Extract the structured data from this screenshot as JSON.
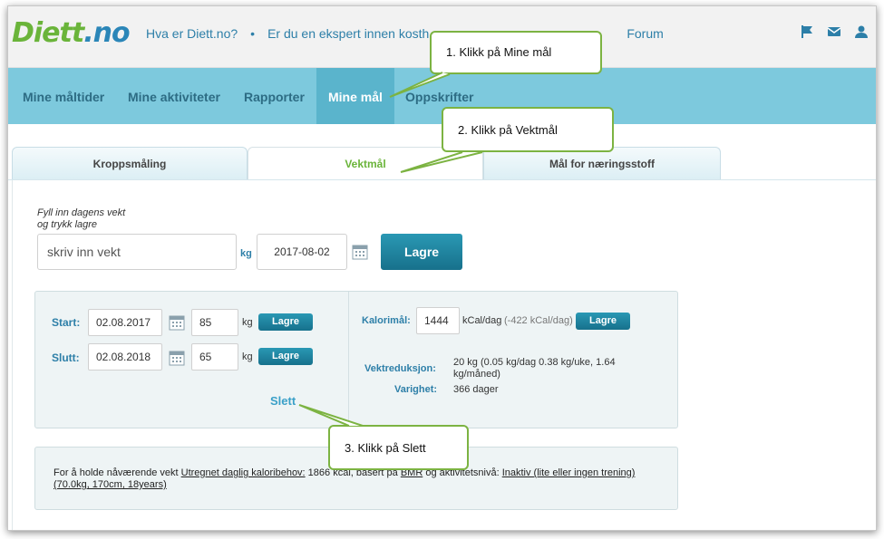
{
  "logo": {
    "part1": "Diett",
    "part2": ".no"
  },
  "topnav": {
    "link1": "Hva er Diett.no?",
    "link2": "Er du en ekspert innen kosth",
    "link3": "Forum"
  },
  "mainnav": {
    "items": [
      "Mine måltider",
      "Mine aktiviteter",
      "Rapporter",
      "Mine mål",
      "Oppskrifter"
    ]
  },
  "tabs": [
    "Kroppsmåling",
    "Vektmål",
    "Mål for næringsstoff"
  ],
  "weight_form": {
    "hint_line1": "Fyll inn dagens vekt",
    "hint_line2": "og trykk lagre",
    "weight_placeholder": "skriv inn vekt",
    "unit": "kg",
    "date_value": "2017-08-02",
    "save_label": "Lagre"
  },
  "goal_panel": {
    "start_label": "Start:",
    "start_date": "02.08.2017",
    "start_weight": "85",
    "end_label": "Slutt:",
    "end_date": "02.08.2018",
    "end_weight": "65",
    "unit": "kg",
    "save_label": "Lagre",
    "delete_label": "Slett"
  },
  "calorie_panel": {
    "calorie_label": "Kalorimål:",
    "calorie_value": "1444",
    "calorie_unit": "kCal/dag",
    "calorie_diff": "(-422 kCal/dag)",
    "save_label": "Lagre",
    "reduction_label": "Vektreduksjon:",
    "reduction_line1": "20 kg (0.05 kg/dag 0.38 kg/uke, 1.64",
    "reduction_line2": "kg/måned)",
    "duration_label": "Varighet:",
    "duration_value": "366 dager"
  },
  "info": {
    "prefix": "For å holde nåværende vekt ",
    "link1": "Utregnet daglig kaloribehov:",
    "mid1": " 1866 kcal, basert på ",
    "link2": "BMR",
    "mid2": " og aktivitetsnivå: ",
    "link3": "Inaktiv (lite eller ingen trening)",
    "link4": "(70.0kg, 170cm, 18years)"
  },
  "callouts": {
    "step1": "1. Klikk på Mine mål",
    "step2": "2. Klikk på Vektmål",
    "step3": "3. Klikk på Slett"
  },
  "colors": {
    "brand_green": "#6ab43a",
    "brand_blue": "#2b86b8",
    "nav_bg": "#7dc9dd",
    "button_blue": "#1f84a0",
    "callout_border": "#7cb342"
  }
}
